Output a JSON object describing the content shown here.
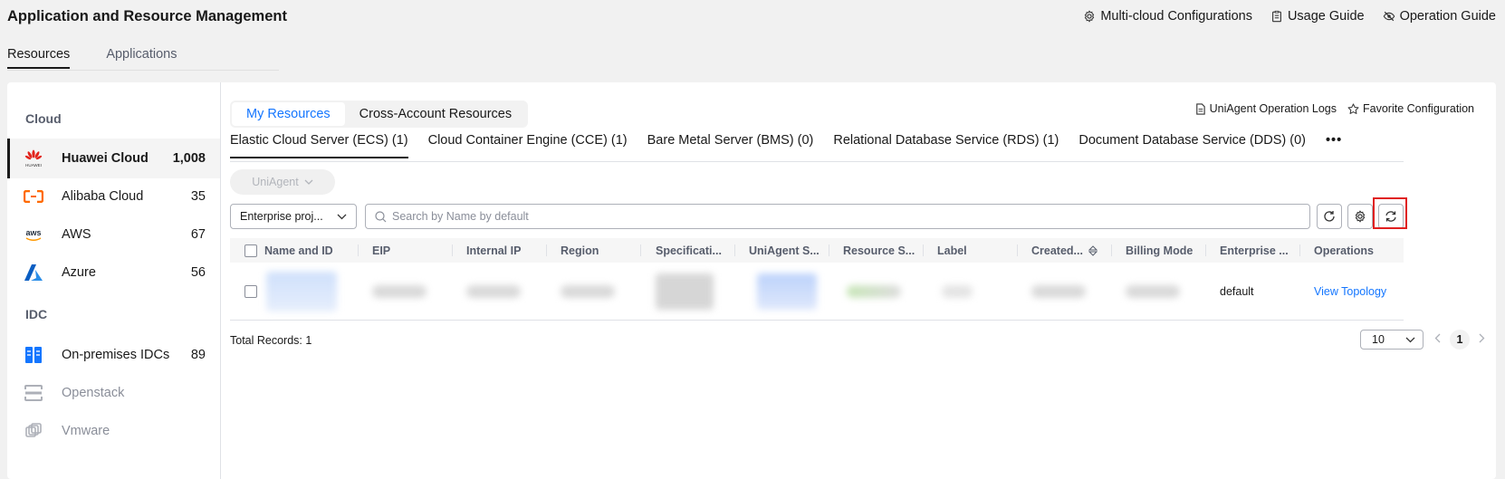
{
  "header": {
    "title": "Application and Resource Management",
    "links": [
      {
        "label": "Multi-cloud Configurations",
        "icon": "gear-icon"
      },
      {
        "label": "Usage Guide",
        "icon": "clipboard-icon"
      },
      {
        "label": "Operation Guide",
        "icon": "eye-off-icon"
      }
    ]
  },
  "main_tabs": [
    {
      "label": "Resources",
      "active": true
    },
    {
      "label": "Applications",
      "active": false
    }
  ],
  "sidebar": {
    "cloud_heading": "Cloud",
    "idc_heading": "IDC",
    "cloud_items": [
      {
        "label": "Huawei Cloud",
        "count": "1,008",
        "icon": "huawei-icon",
        "active": true
      },
      {
        "label": "Alibaba Cloud",
        "count": "35",
        "icon": "alibaba-icon"
      },
      {
        "label": "AWS",
        "count": "67",
        "icon": "aws-icon"
      },
      {
        "label": "Azure",
        "count": "56",
        "icon": "azure-icon"
      }
    ],
    "idc_items": [
      {
        "label": "On-premises IDCs",
        "count": "89",
        "icon": "server-icon"
      },
      {
        "label": "Openstack",
        "count": "",
        "icon": "openstack-icon"
      },
      {
        "label": "Vmware",
        "count": "",
        "icon": "vmware-icon"
      }
    ]
  },
  "segment": {
    "my_resources": "My Resources",
    "cross_account": "Cross-Account Resources"
  },
  "right_links": {
    "logs": "UniAgent Operation Logs",
    "favorite": "Favorite Configuration"
  },
  "service_tabs": [
    "Elastic Cloud Server (ECS) (1)",
    "Cloud Container Engine (CCE) (1)",
    "Bare Metal Server (BMS) (0)",
    "Relational Database Service (RDS) (1)",
    "Document Database Service (DDS) (0)"
  ],
  "service_more": "•••",
  "uniagent_button": "UniAgent",
  "filters": {
    "enterprise_project": "Enterprise proj...",
    "search_placeholder": "Search by Name by default"
  },
  "table": {
    "headers": [
      "Name and ID",
      "EIP",
      "Internal IP",
      "Region",
      "Specificati...",
      "UniAgent S...",
      "Resource S...",
      "Label",
      "Created...",
      "Billing Mode",
      "Enterprise ...",
      "Operations"
    ],
    "row": {
      "enterprise_project": "default",
      "operation": "View Topology"
    }
  },
  "footer": {
    "total": "Total Records: 1",
    "page_size": "10",
    "current_page": "1"
  },
  "colors": {
    "accent": "#1476ff",
    "highlight": "#e02020"
  }
}
